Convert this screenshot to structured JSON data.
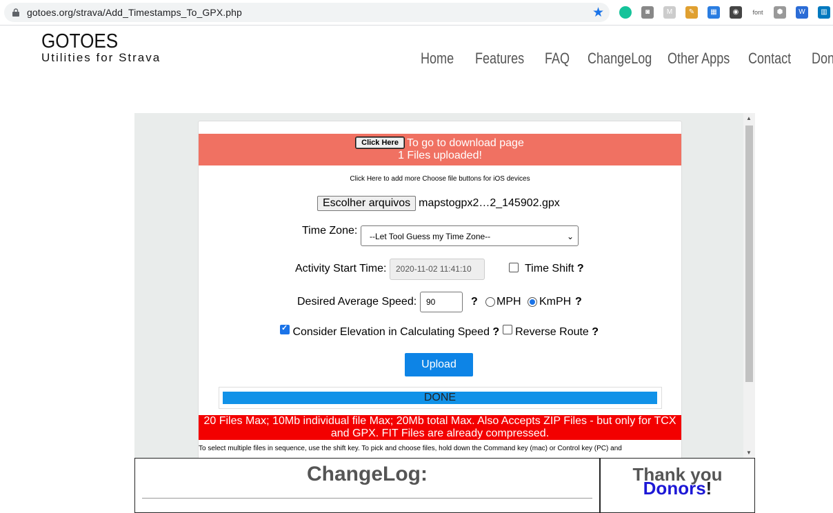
{
  "browser": {
    "url": "gotoes.org/strava/Add_Timestamps_To_GPX.php",
    "extensions": [
      {
        "name": "grammarly-icon",
        "color": "#15c39a",
        "glyph": ""
      },
      {
        "name": "camera-icon",
        "color": "#888888",
        "glyph": "◙"
      },
      {
        "name": "m-extension-icon",
        "color": "#cccccc",
        "glyph": "M"
      },
      {
        "name": "paint-extension-icon",
        "color": "#e0a030",
        "glyph": "✎"
      },
      {
        "name": "blue-square-extension-icon",
        "color": "#2a7de1",
        "glyph": "▦"
      },
      {
        "name": "mask-extension-icon",
        "color": "#444444",
        "glyph": "◉"
      },
      {
        "name": "font-extension-icon",
        "color": "#ffffff",
        "glyph": "font"
      },
      {
        "name": "hexagon-extension-icon",
        "color": "#999999",
        "glyph": "⬢"
      },
      {
        "name": "w-extension-icon",
        "color": "#2b6cd6",
        "glyph": "W"
      },
      {
        "name": "trello-icon",
        "color": "#0079bf",
        "glyph": "▥"
      }
    ]
  },
  "site": {
    "logo_title": "GOTOES",
    "logo_subtitle": "Utilities for Strava",
    "nav": [
      "Home",
      "Features",
      "FAQ",
      "ChangeLog",
      "Other Apps",
      "Contact",
      "Dona"
    ]
  },
  "form": {
    "click_here_label": "Click Here",
    "banner_text": "To go to download page",
    "banner_line2": "1 Files uploaded!",
    "ios_note": "Click Here to add more Choose file buttons for iOS devices",
    "choose_files_label": "Escolher arquivos",
    "chosen_file": "mapstogpx2…2_145902.gpx",
    "timezone_label": "Time Zone:",
    "timezone_value": "--Let Tool Guess my Time Zone--",
    "start_time_label": "Activity Start Time:",
    "start_time_value": "2020-11-02 11:41:10",
    "time_shift_label": "Time Shift",
    "speed_label": "Desired Average Speed:",
    "speed_value": "90",
    "mph_label": "MPH",
    "kmph_label": "KmPH",
    "unit_selected": "KmPH",
    "elevation_label": "Consider Elevation in Calculating Speed",
    "elevation_checked": true,
    "reverse_label": "Reverse Route",
    "reverse_checked": false,
    "help_mark": "?",
    "upload_label": "Upload",
    "progress_text": "DONE",
    "progress_fraction": 1.0,
    "limits_note": "20 Files Max; 10Mb individual file Max; 20Mb total Max. Also Accepts ZIP Files - but only for TCX and GPX. FIT Files are already compressed.",
    "select_note": "To select multiple files in sequence, use the shift key. To pick and choose files, hold down the Command key (mac) or Control key (PC) and"
  },
  "bottom": {
    "changelog_title": "ChangeLog:",
    "thanks_line1": "Thank you",
    "thanks_donors": "Donors",
    "thanks_excl": "!"
  }
}
